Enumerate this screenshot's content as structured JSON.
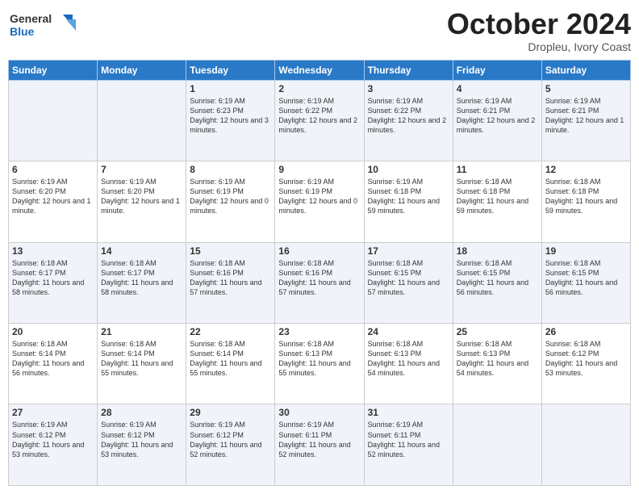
{
  "logo": {
    "line1": "General",
    "line2": "Blue"
  },
  "header": {
    "month": "October 2024",
    "location": "Dropleu, Ivory Coast"
  },
  "weekdays": [
    "Sunday",
    "Monday",
    "Tuesday",
    "Wednesday",
    "Thursday",
    "Friday",
    "Saturday"
  ],
  "weeks": [
    [
      {
        "day": "",
        "info": ""
      },
      {
        "day": "",
        "info": ""
      },
      {
        "day": "1",
        "info": "Sunrise: 6:19 AM\nSunset: 6:23 PM\nDaylight: 12 hours and 3 minutes."
      },
      {
        "day": "2",
        "info": "Sunrise: 6:19 AM\nSunset: 6:22 PM\nDaylight: 12 hours and 2 minutes."
      },
      {
        "day": "3",
        "info": "Sunrise: 6:19 AM\nSunset: 6:22 PM\nDaylight: 12 hours and 2 minutes."
      },
      {
        "day": "4",
        "info": "Sunrise: 6:19 AM\nSunset: 6:21 PM\nDaylight: 12 hours and 2 minutes."
      },
      {
        "day": "5",
        "info": "Sunrise: 6:19 AM\nSunset: 6:21 PM\nDaylight: 12 hours and 1 minute."
      }
    ],
    [
      {
        "day": "6",
        "info": "Sunrise: 6:19 AM\nSunset: 6:20 PM\nDaylight: 12 hours and 1 minute."
      },
      {
        "day": "7",
        "info": "Sunrise: 6:19 AM\nSunset: 6:20 PM\nDaylight: 12 hours and 1 minute."
      },
      {
        "day": "8",
        "info": "Sunrise: 6:19 AM\nSunset: 6:19 PM\nDaylight: 12 hours and 0 minutes."
      },
      {
        "day": "9",
        "info": "Sunrise: 6:19 AM\nSunset: 6:19 PM\nDaylight: 12 hours and 0 minutes."
      },
      {
        "day": "10",
        "info": "Sunrise: 6:19 AM\nSunset: 6:18 PM\nDaylight: 11 hours and 59 minutes."
      },
      {
        "day": "11",
        "info": "Sunrise: 6:18 AM\nSunset: 6:18 PM\nDaylight: 11 hours and 59 minutes."
      },
      {
        "day": "12",
        "info": "Sunrise: 6:18 AM\nSunset: 6:18 PM\nDaylight: 11 hours and 59 minutes."
      }
    ],
    [
      {
        "day": "13",
        "info": "Sunrise: 6:18 AM\nSunset: 6:17 PM\nDaylight: 11 hours and 58 minutes."
      },
      {
        "day": "14",
        "info": "Sunrise: 6:18 AM\nSunset: 6:17 PM\nDaylight: 11 hours and 58 minutes."
      },
      {
        "day": "15",
        "info": "Sunrise: 6:18 AM\nSunset: 6:16 PM\nDaylight: 11 hours and 57 minutes."
      },
      {
        "day": "16",
        "info": "Sunrise: 6:18 AM\nSunset: 6:16 PM\nDaylight: 11 hours and 57 minutes."
      },
      {
        "day": "17",
        "info": "Sunrise: 6:18 AM\nSunset: 6:15 PM\nDaylight: 11 hours and 57 minutes."
      },
      {
        "day": "18",
        "info": "Sunrise: 6:18 AM\nSunset: 6:15 PM\nDaylight: 11 hours and 56 minutes."
      },
      {
        "day": "19",
        "info": "Sunrise: 6:18 AM\nSunset: 6:15 PM\nDaylight: 11 hours and 56 minutes."
      }
    ],
    [
      {
        "day": "20",
        "info": "Sunrise: 6:18 AM\nSunset: 6:14 PM\nDaylight: 11 hours and 56 minutes."
      },
      {
        "day": "21",
        "info": "Sunrise: 6:18 AM\nSunset: 6:14 PM\nDaylight: 11 hours and 55 minutes."
      },
      {
        "day": "22",
        "info": "Sunrise: 6:18 AM\nSunset: 6:14 PM\nDaylight: 11 hours and 55 minutes."
      },
      {
        "day": "23",
        "info": "Sunrise: 6:18 AM\nSunset: 6:13 PM\nDaylight: 11 hours and 55 minutes."
      },
      {
        "day": "24",
        "info": "Sunrise: 6:18 AM\nSunset: 6:13 PM\nDaylight: 11 hours and 54 minutes."
      },
      {
        "day": "25",
        "info": "Sunrise: 6:18 AM\nSunset: 6:13 PM\nDaylight: 11 hours and 54 minutes."
      },
      {
        "day": "26",
        "info": "Sunrise: 6:18 AM\nSunset: 6:12 PM\nDaylight: 11 hours and 53 minutes."
      }
    ],
    [
      {
        "day": "27",
        "info": "Sunrise: 6:19 AM\nSunset: 6:12 PM\nDaylight: 11 hours and 53 minutes."
      },
      {
        "day": "28",
        "info": "Sunrise: 6:19 AM\nSunset: 6:12 PM\nDaylight: 11 hours and 53 minutes."
      },
      {
        "day": "29",
        "info": "Sunrise: 6:19 AM\nSunset: 6:12 PM\nDaylight: 11 hours and 52 minutes."
      },
      {
        "day": "30",
        "info": "Sunrise: 6:19 AM\nSunset: 6:11 PM\nDaylight: 11 hours and 52 minutes."
      },
      {
        "day": "31",
        "info": "Sunrise: 6:19 AM\nSunset: 6:11 PM\nDaylight: 11 hours and 52 minutes."
      },
      {
        "day": "",
        "info": ""
      },
      {
        "day": "",
        "info": ""
      }
    ]
  ]
}
